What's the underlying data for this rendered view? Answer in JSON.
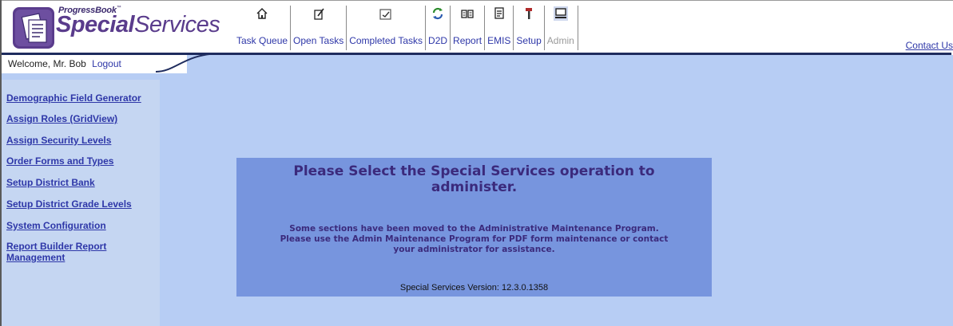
{
  "header": {
    "logo_small": "ProgressBook",
    "logo_tm": "™",
    "logo_bold": "Special",
    "logo_light": "Services",
    "welcome": "Welcome, Mr. Bob",
    "logout": "Logout",
    "contact_us": "Contact Us"
  },
  "toolbar": [
    {
      "label": "Task Queue",
      "icon": "home-icon",
      "enabled": true
    },
    {
      "label": "Open Tasks",
      "icon": "edit-document-icon",
      "enabled": true
    },
    {
      "label": "Completed Tasks",
      "icon": "completed-document-icon",
      "enabled": true
    },
    {
      "label": "D2D",
      "icon": "refresh-icon",
      "enabled": true
    },
    {
      "label": "Report",
      "icon": "report-icon",
      "enabled": true
    },
    {
      "label": "EMIS",
      "icon": "emis-document-icon",
      "enabled": true
    },
    {
      "label": "Setup",
      "icon": "wrench-hammer-icon",
      "enabled": true
    },
    {
      "label": "Admin",
      "icon": "computer-icon",
      "enabled": false
    }
  ],
  "sidebar": {
    "items": [
      "Demographic Field Generator",
      "Assign Roles (GridView)",
      "Assign Security Levels",
      "Order Forms and Types",
      "Setup District Bank",
      "Setup District Grade Levels",
      "System Configuration",
      "Report Builder Report Management"
    ]
  },
  "main": {
    "title_line1": "Please Select the Special Services operation to",
    "title_line2": "administer.",
    "note_line1": "Some sections have been moved to the Administrative Maintenance Program.",
    "note_line2": "Please use the Admin Maintenance Program for PDF form maintenance or contact",
    "note_line3": "your administrator for assistance.",
    "version": "Special Services Version: 12.3.0.1358"
  },
  "colors": {
    "brand_purple": "#5a3c8c",
    "link_blue": "#2e37a8",
    "content_bg": "#b7cdf4",
    "sidebar_bg": "#c5d6f2",
    "panel_bg": "#7795de",
    "header_rule": "#1f2c5e"
  }
}
